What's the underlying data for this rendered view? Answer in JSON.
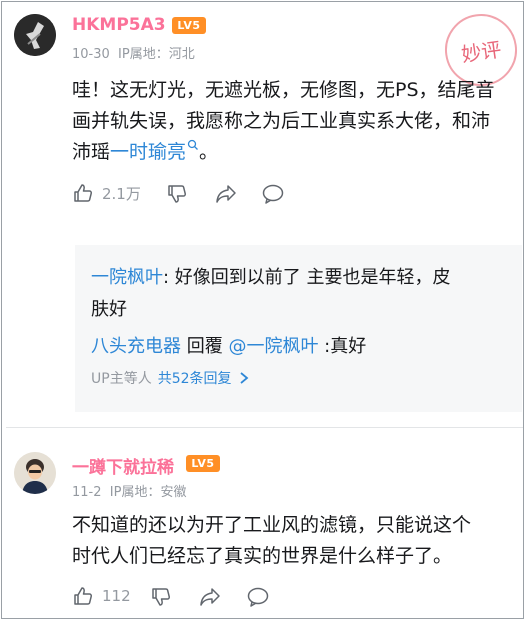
{
  "comments": [
    {
      "username": "HKMP5A3",
      "level_badge": "LV5",
      "date": "10-30",
      "ip_location": "IP属地：河北",
      "content_lines": [
        "哇！这无灯光，无遮光板，无修图，无PS，结尾音",
        "画并轨失误，我愿称之为后工业真实系大佬，和沛"
      ],
      "content_line3_prefix": "沛瑶",
      "content_link": "一时瑜亮",
      "content_line3_suffix": "。",
      "like_count": "2.1万"
    },
    {
      "username": "一蹲下就拉稀",
      "level_badge": "LV5",
      "date": "11-2",
      "ip_location": "IP属地：安徽",
      "content_lines": [
        "不知道的还以为开了工业风的滤镜，只能说这个",
        "时代人们已经忘了真实的世界是什么样子了。"
      ],
      "like_count": "112"
    }
  ],
  "replies": {
    "reply1_name": "一院枫叶",
    "reply1_text_line1": ": 好像回到以前了 主要也是年轻，皮",
    "reply1_text_line2": "肤好",
    "reply2_name": "八头充电器",
    "reply2_verb": " 回覆 ",
    "reply2_mention": "@一院枫叶",
    "reply2_text": " :真好",
    "more_prefix": "UP主等人",
    "more_count": "共52条回复"
  },
  "stamp_text": "妙评",
  "colors": {
    "username": "#fb7299",
    "link": "#2e87d6",
    "badge": "#ff8f26",
    "meta": "#9499a0"
  }
}
